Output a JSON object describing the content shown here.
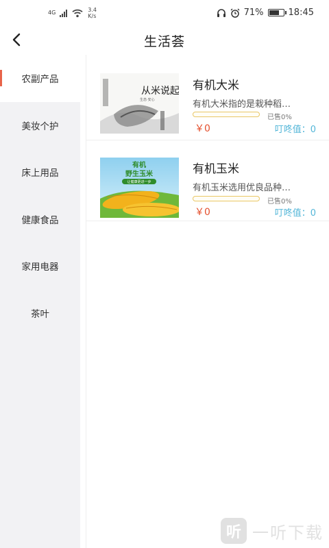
{
  "status_bar": {
    "network": "4G",
    "speed_value": "3.4",
    "speed_unit": "K/s",
    "battery": "71%",
    "time": "18:45"
  },
  "header": {
    "back_icon": "chevron-left-icon",
    "title": "生活荟"
  },
  "sidebar": {
    "items": [
      {
        "label": "农副产品",
        "active": true
      },
      {
        "label": "美妆个护",
        "active": false
      },
      {
        "label": "床上用品",
        "active": false
      },
      {
        "label": "健康食品",
        "active": false
      },
      {
        "label": "家用电器",
        "active": false
      },
      {
        "label": "茶叶",
        "active": false
      }
    ],
    "accent_color": "#e8644a"
  },
  "products": [
    {
      "name": "有机大米",
      "desc": "有机大米指的是栽种稻…",
      "sold_label": "已售0%",
      "sold_fraction": 0,
      "price": "￥0",
      "points": "叮咚值：0",
      "image": {
        "calligraphy": "从米说起",
        "small_text": "生态·安心"
      }
    },
    {
      "name": "有机玉米",
      "desc": "有机玉米选用优良品种…",
      "sold_label": "已售0%",
      "sold_fraction": 0,
      "price": "￥0",
      "points": "叮咚值：0",
      "image": {
        "title_line1": "有机",
        "title_line2": "野生玉米",
        "subtitle": "让健康更进一步"
      }
    }
  ],
  "watermark": {
    "logo": "听",
    "text": "一听下载"
  },
  "colors": {
    "price": "#e4502e",
    "points": "#53b6d8",
    "progress": "#e9c766"
  }
}
